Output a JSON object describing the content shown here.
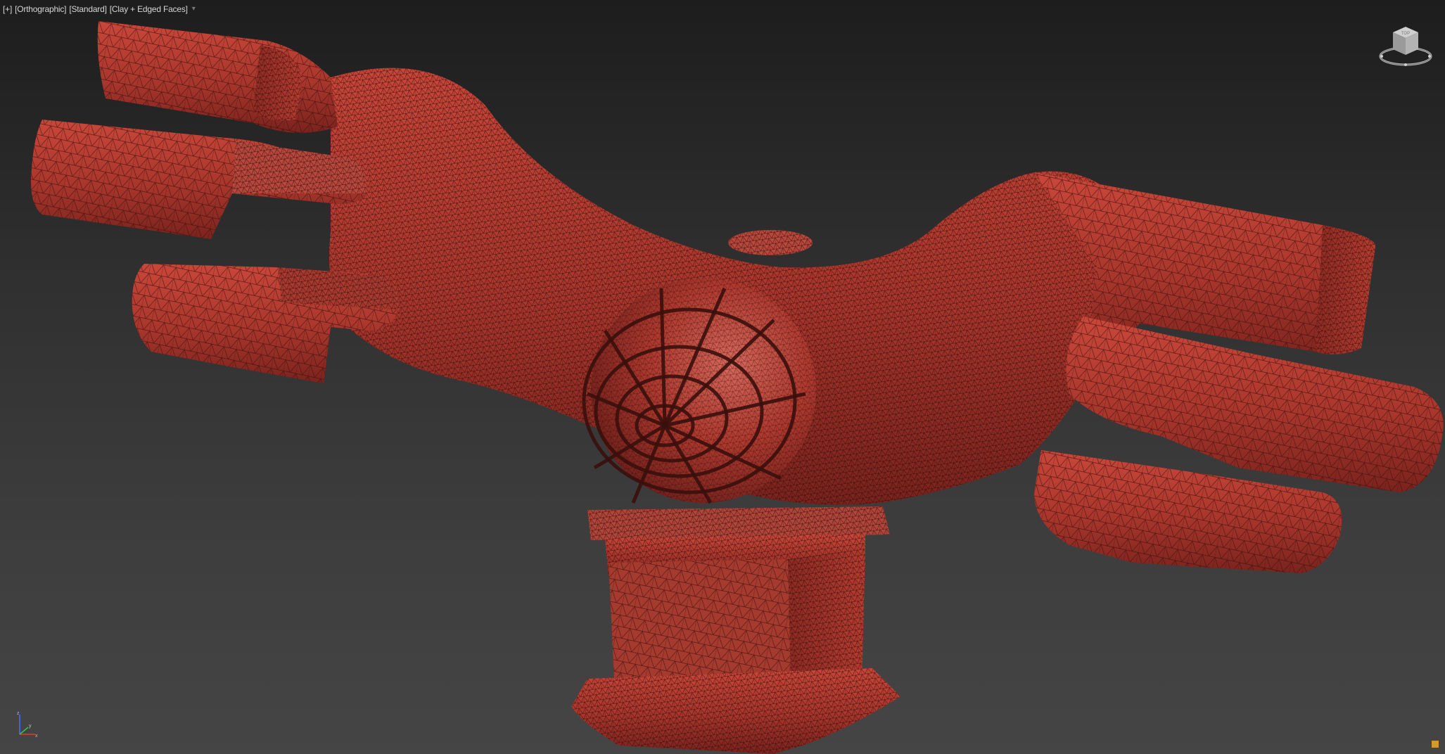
{
  "viewport": {
    "label_parts": [
      "[+]",
      "[Orthographic]",
      "[Standard]",
      "[Clay + Edged Faces]"
    ],
    "label_end_icon": "filter-icon",
    "viewcube_text": "TOP",
    "mesh_color": "#b0392f",
    "wire_color": "#3a0f0c",
    "background_top": "#1d1d1d",
    "background_bottom": "#454545",
    "axis_labels": {
      "x": "x",
      "y": "y",
      "z": "z"
    },
    "corner_button_icon": "maximize-icon"
  }
}
